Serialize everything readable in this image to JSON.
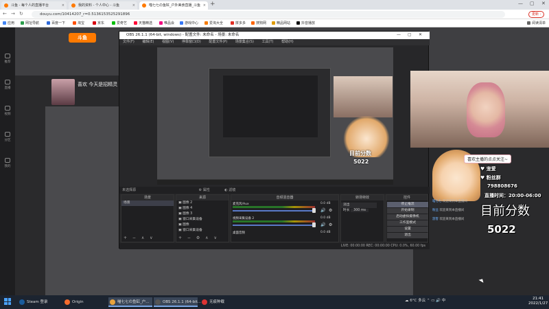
{
  "browser": {
    "tabs": [
      {
        "label": "斗鱼 - 每个人的直播平台",
        "color": "#ff7a00"
      },
      {
        "label": "我的资料 - 个人中心 - 斗鱼",
        "color": "#ff7a00"
      },
      {
        "label": "喵七七の鱼缸_户外美食直播_斗鱼",
        "color": "#ff7a00",
        "active": true
      }
    ],
    "url": "douyu.com/10414207_r=0.5136153525291896",
    "update_label": "更新 :",
    "bookmarks": [
      "应用",
      "网址导航",
      "百度一下",
      "淘宝",
      "京东",
      "爱奇艺",
      "天猫精选",
      "唯品会",
      "游戏中心",
      "爱淘大全",
      "拼多多",
      "搜狗网",
      "精品网站",
      "抖音播放",
      "阅读清单"
    ]
  },
  "douyu": {
    "logo": "斗鱼",
    "room_title": "喜欢 今天是招精灵",
    "left_nav": [
      "推荐",
      "直播",
      "视频",
      "分区",
      "我的"
    ]
  },
  "obs": {
    "title": "OBS 26.1.1 (64-bit, windows) - 配置文件: 未命名 - 场景: 未命名",
    "menu": [
      "文件(F)",
      "编辑(E)",
      "视图(V)",
      "停靠窗口(D)",
      "配置文件(P)",
      "场景集合(S)",
      "工具(T)",
      "帮助(H)"
    ],
    "no_source": "未选择源",
    "props_label": "属性",
    "filters_label": "滤镜",
    "scenes_header": "场景",
    "scenes": [
      "场景"
    ],
    "sources_header": "来源",
    "sources": [
      "图像 2",
      "图像 4",
      "图像 3",
      "窗口采集设备",
      "图像",
      "窗口采集设备"
    ],
    "mixer_header": "音频混音器",
    "mixer": [
      {
        "name": "麦克风/Aux",
        "value": "0.0 dB"
      },
      {
        "name": "视频采集设备 2",
        "value": "0.0 dB"
      },
      {
        "name": "桌面音频",
        "value": "0.0 dB"
      }
    ],
    "transition_header": "转场特效",
    "transition_type": "淡出",
    "duration_label": "时长",
    "duration_value": "300 ms",
    "controls_header": "控件",
    "controls": [
      "停止推流",
      "开始录制",
      "启动虚拟摄像机",
      "工作室模式",
      "设置",
      "退出"
    ],
    "status": "LIVE: 00:00:00   REC: 00:00:00   CPU: 0.0%, 60.00 fps",
    "mini_score_label": "目前分数",
    "mini_score": "5022"
  },
  "stream": {
    "welcome": "喜欢主播的点点关注~",
    "fan_label": "♥ 宠爱",
    "qq_label": "♥ 粉丝群",
    "qq_number": "798808676",
    "time_label": "直播时间：",
    "time_value": "20:00-06:00",
    "score_label": "目前分数",
    "score": "5022",
    "chat": [
      {
        "user": "喵七七",
        "text": "欢迎来到本直播间"
      },
      {
        "user": "粉丝",
        "text": "欢迎来到本直播间"
      },
      {
        "user": "游客",
        "text": "欢迎来到本直播间"
      }
    ]
  },
  "taskbar": {
    "items": [
      {
        "label": "Steam 登录",
        "color": "#1b5c9c"
      },
      {
        "label": "Origin",
        "color": "#f56c2d"
      },
      {
        "label": "喵七七の鱼缸_户...",
        "color": "#e8a33d",
        "active": true
      },
      {
        "label": "OBS 26.1.1 (64-bit...",
        "color": "#555",
        "active": true
      },
      {
        "label": "无痕种载",
        "color": "#d33"
      }
    ],
    "weather": "6°C 多云",
    "time": "21:41",
    "date": "2022/1/27"
  }
}
